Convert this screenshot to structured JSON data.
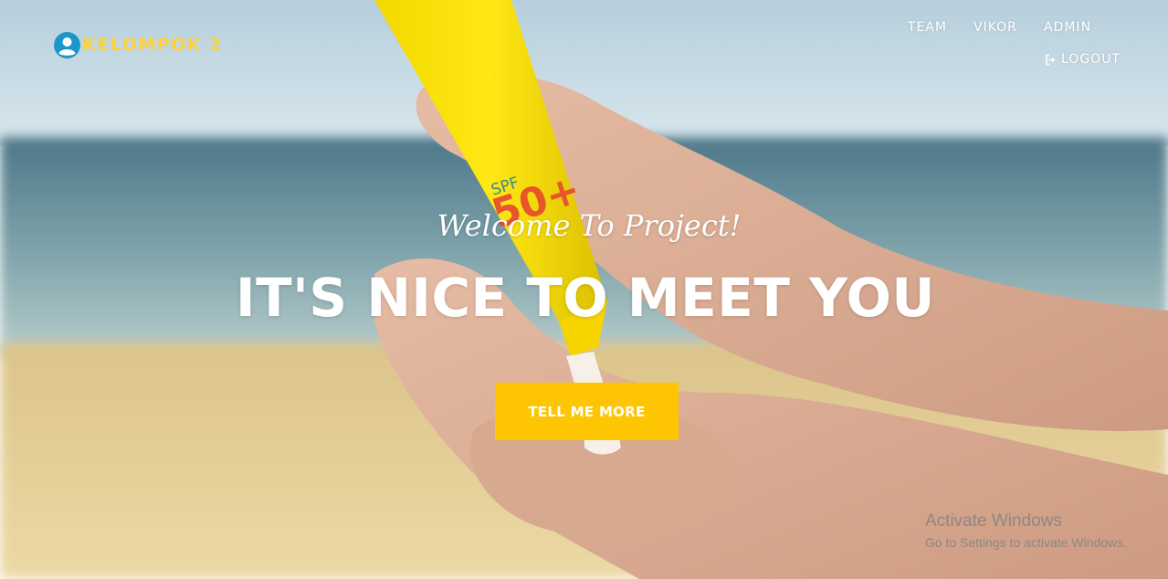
{
  "brand": {
    "name": "KELOMPOK 2",
    "icon": "user-circle-icon"
  },
  "nav": {
    "items": [
      {
        "label": "TEAM"
      },
      {
        "label": "VIKOR"
      },
      {
        "label": "ADMIN"
      }
    ],
    "logout": {
      "label": "LOGOUT",
      "icon": "sign-out-icon"
    }
  },
  "hero": {
    "welcome": "Welcome To Project!",
    "headline": "IT'S NICE TO MEET YOU",
    "cta_label": "TELL ME MORE",
    "bottle_label_top": "SPF",
    "bottle_label_value": "50+"
  },
  "watermark": {
    "title": "Activate Windows",
    "subtitle": "Go to Settings to activate Windows."
  },
  "colors": {
    "accent": "#fec503",
    "brand_text": "#fed136",
    "brand_icon": "#1c97c9"
  }
}
